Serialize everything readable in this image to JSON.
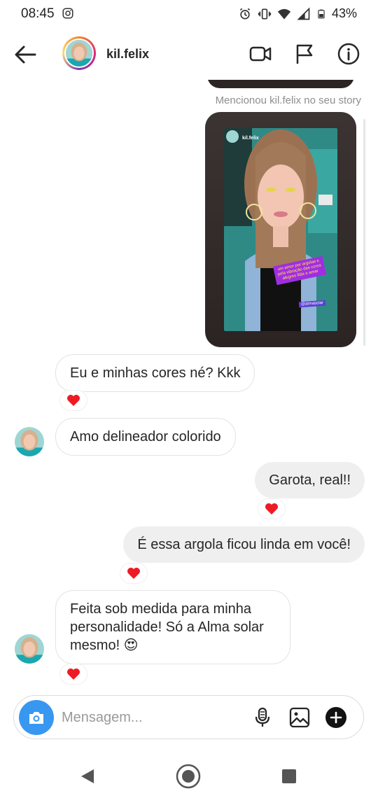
{
  "status": {
    "time": "08:45",
    "battery": "43%"
  },
  "header": {
    "username": "kil.felix"
  },
  "chat": {
    "mention_caption": "Mencionou kil.felix no seu story",
    "story": {
      "username": "kil.felix",
      "sticker_text": "um amor por argolas e pela vibração das cores alegres lilás e amar",
      "tag_text": "@almasolar"
    },
    "messages": [
      {
        "id": "m1",
        "text": "Eu e minhas cores né? Kkk",
        "direction": "incoming",
        "reaction": "heart"
      },
      {
        "id": "m2",
        "text": "Amo delineador colorido",
        "direction": "incoming",
        "reaction": ""
      },
      {
        "id": "m3",
        "text": "Garota, real!!",
        "direction": "outgoing",
        "reaction": "heart"
      },
      {
        "id": "m4",
        "text": "É essa argola ficou linda em você!",
        "direction": "outgoing",
        "reaction": "heart"
      },
      {
        "id": "m5",
        "text": "Feita sob medida para minha personalidade! Só a Alma solar mesmo! 😍",
        "direction": "incoming",
        "reaction": "heart"
      }
    ]
  },
  "composer": {
    "placeholder": "Mensagem..."
  },
  "colors": {
    "accent": "#3897f0",
    "heart": "#ed1c24",
    "outgoing_bubble": "#efefef"
  },
  "icons": [
    "back-arrow-icon",
    "video-call-icon",
    "flag-icon",
    "info-icon",
    "camera-icon",
    "microphone-icon",
    "gallery-icon",
    "plus-icon",
    "heart-icon"
  ]
}
